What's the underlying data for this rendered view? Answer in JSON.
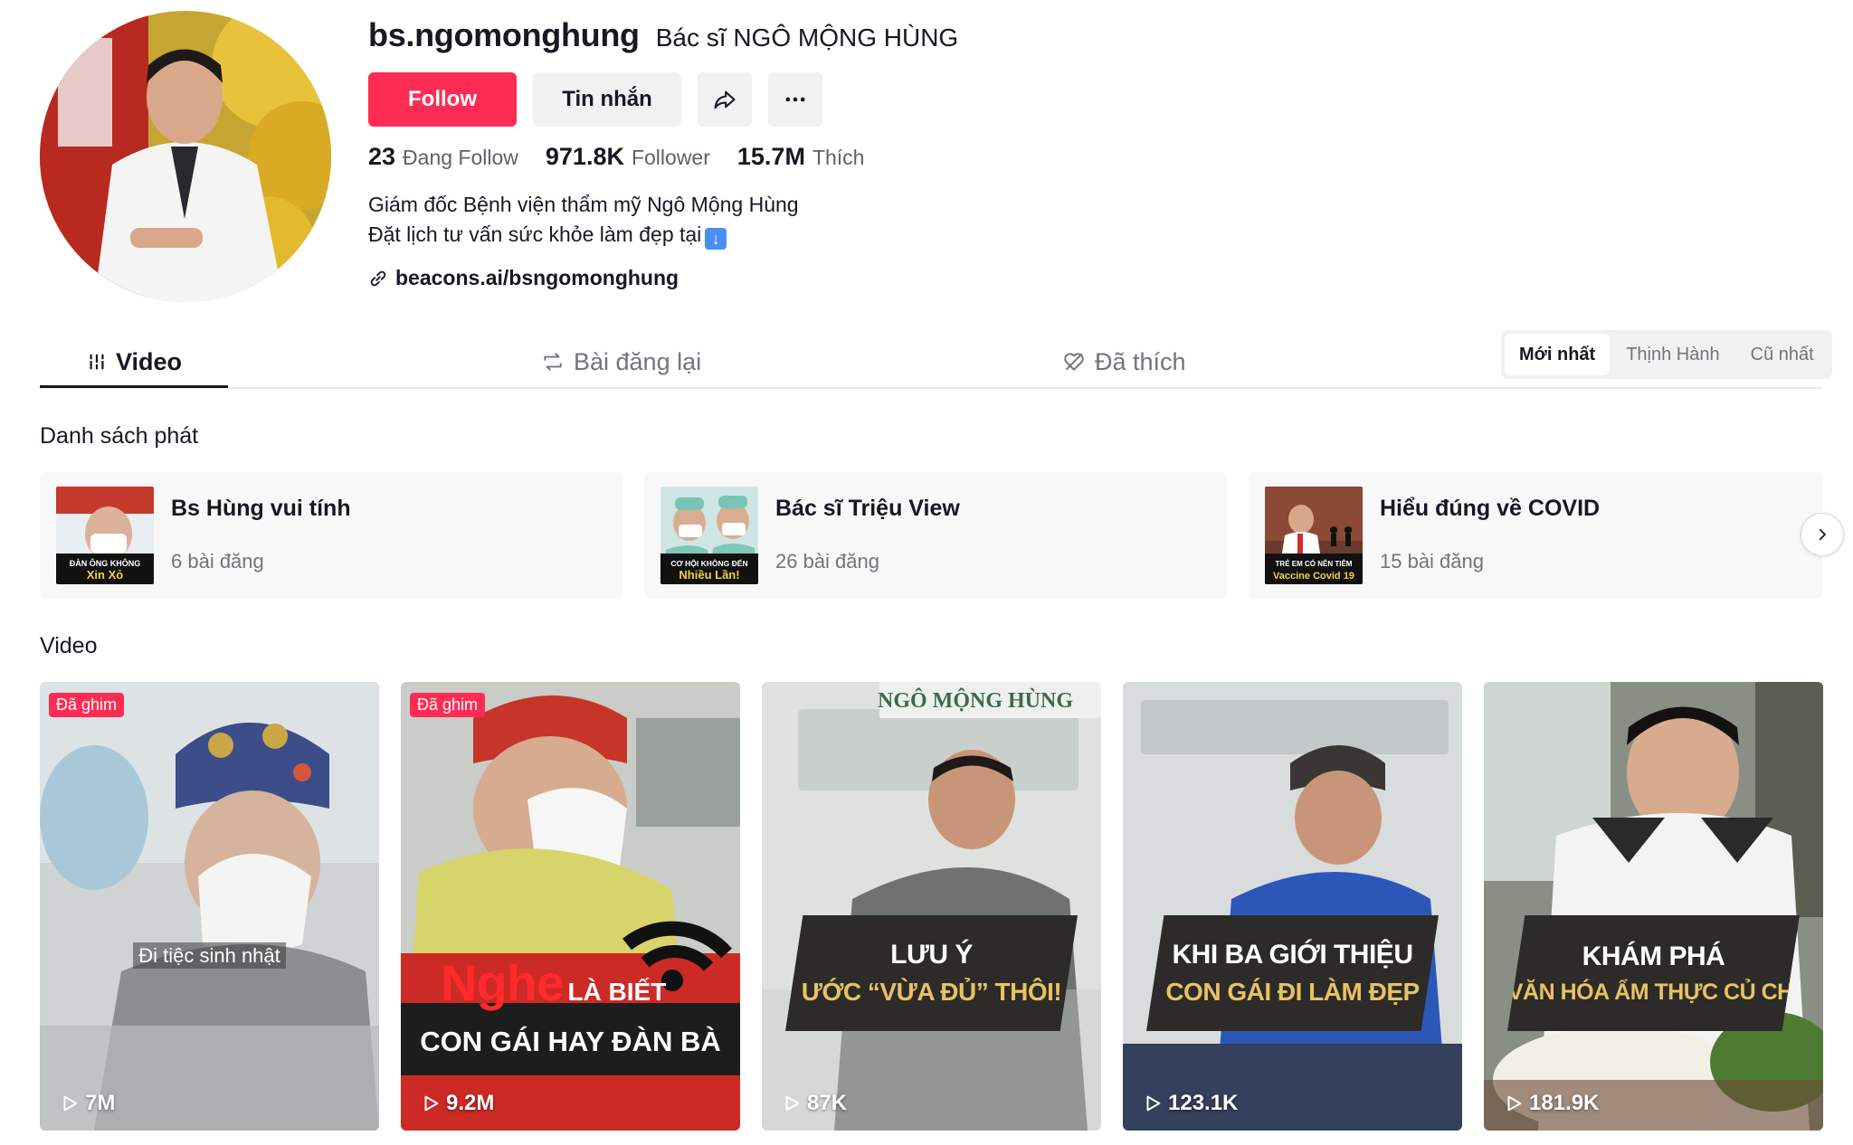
{
  "profile": {
    "username": "bs.ngomonghung",
    "nickname": "Bác sĩ NGÔ MỘNG HÙNG",
    "follow_label": "Follow",
    "message_label": "Tin nhắn",
    "stats": {
      "following_count": "23",
      "following_label": "Đang Follow",
      "followers_count": "971.8K",
      "followers_label": "Follower",
      "likes_count": "15.7M",
      "likes_label": "Thích"
    },
    "bio_line1": "Giám đốc Bệnh viện thẩm mỹ Ngô Mộng Hùng",
    "bio_line2": "Đặt lịch tư vấn sức khỏe làm đẹp tại",
    "link": "beacons.ai/bsngomonghung"
  },
  "tabs": {
    "video": "Video",
    "reposts": "Bài đăng lại",
    "liked": "Đã thích"
  },
  "sort": {
    "newest": "Mới nhất",
    "trending": "Thịnh Hành",
    "oldest": "Cũ nhất"
  },
  "playlists_title": "Danh sách phát",
  "playlists": [
    {
      "title": "Bs Hùng vui tính",
      "count": "6 bài đăng",
      "thumb_line1": "ĐÀN ÔNG KHÔNG",
      "thumb_line2": "Xin Xỏ"
    },
    {
      "title": "Bác sĩ Triệu View",
      "count": "26 bài đăng",
      "thumb_line1": "CƠ HỘI KHÔNG ĐẾN",
      "thumb_line2": "Nhiều Lần!"
    },
    {
      "title": "Hiểu đúng về COVID",
      "count": "15 bài đăng",
      "thumb_line1": "TRẺ EM CÓ NÊN TIÊM",
      "thumb_line2": "Vaccine Covid 19"
    }
  ],
  "videos_title": "Video",
  "videos": [
    {
      "views": "7M",
      "pinned": "Đã ghim",
      "caption": "Đi tiệc sinh nhật"
    },
    {
      "views": "9.2M",
      "pinned": "Đã ghim",
      "caption_big": "Nghe",
      "caption_small": "LÀ BIẾT",
      "caption_line2": "CON GÁI HAY ĐÀN BÀ"
    },
    {
      "views": "87K",
      "sign": "NGÔ MỘNG HÙNG",
      "banner_line1": "LƯU Ý",
      "banner_line2": "ƯỚC “VỪA ĐỦ” THÔI!"
    },
    {
      "views": "123.1K",
      "banner_line1": "KHI BA GIỚI THIỆU",
      "banner_line2": "CON GÁI ĐI LÀM ĐẸP"
    },
    {
      "views": "181.9K",
      "banner_line1": "KHÁM PHÁ",
      "banner_line2": "VĂN HÓA ẨM THỰC CỦ CHI"
    }
  ],
  "colors": {
    "accent": "#fe2c55",
    "text": "#161823",
    "muted": "#73747b",
    "surface": "#f1f1f2"
  }
}
